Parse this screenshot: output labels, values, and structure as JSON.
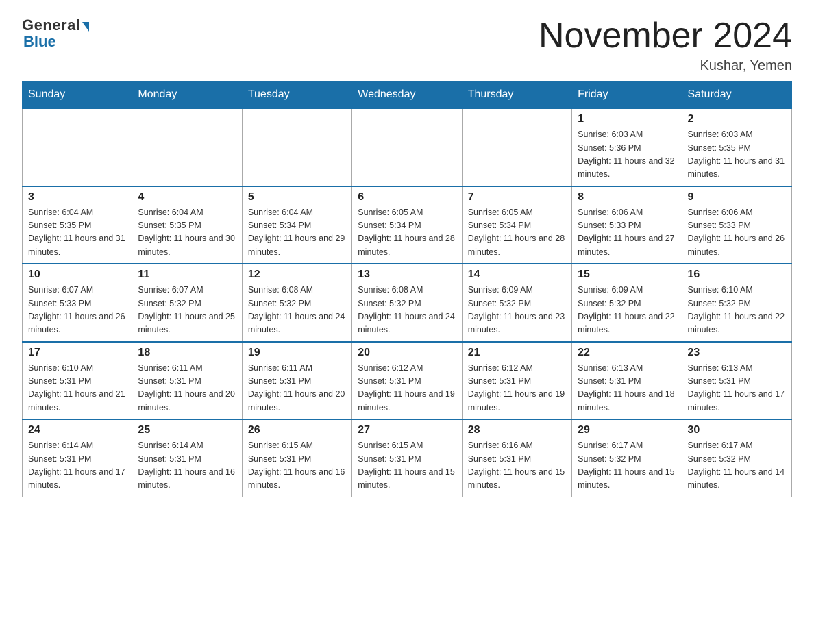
{
  "logo": {
    "general": "General",
    "blue": "Blue"
  },
  "title": "November 2024",
  "location": "Kushar, Yemen",
  "days_of_week": [
    "Sunday",
    "Monday",
    "Tuesday",
    "Wednesday",
    "Thursday",
    "Friday",
    "Saturday"
  ],
  "weeks": [
    [
      {
        "day": "",
        "info": ""
      },
      {
        "day": "",
        "info": ""
      },
      {
        "day": "",
        "info": ""
      },
      {
        "day": "",
        "info": ""
      },
      {
        "day": "",
        "info": ""
      },
      {
        "day": "1",
        "info": "Sunrise: 6:03 AM\nSunset: 5:36 PM\nDaylight: 11 hours and 32 minutes."
      },
      {
        "day": "2",
        "info": "Sunrise: 6:03 AM\nSunset: 5:35 PM\nDaylight: 11 hours and 31 minutes."
      }
    ],
    [
      {
        "day": "3",
        "info": "Sunrise: 6:04 AM\nSunset: 5:35 PM\nDaylight: 11 hours and 31 minutes."
      },
      {
        "day": "4",
        "info": "Sunrise: 6:04 AM\nSunset: 5:35 PM\nDaylight: 11 hours and 30 minutes."
      },
      {
        "day": "5",
        "info": "Sunrise: 6:04 AM\nSunset: 5:34 PM\nDaylight: 11 hours and 29 minutes."
      },
      {
        "day": "6",
        "info": "Sunrise: 6:05 AM\nSunset: 5:34 PM\nDaylight: 11 hours and 28 minutes."
      },
      {
        "day": "7",
        "info": "Sunrise: 6:05 AM\nSunset: 5:34 PM\nDaylight: 11 hours and 28 minutes."
      },
      {
        "day": "8",
        "info": "Sunrise: 6:06 AM\nSunset: 5:33 PM\nDaylight: 11 hours and 27 minutes."
      },
      {
        "day": "9",
        "info": "Sunrise: 6:06 AM\nSunset: 5:33 PM\nDaylight: 11 hours and 26 minutes."
      }
    ],
    [
      {
        "day": "10",
        "info": "Sunrise: 6:07 AM\nSunset: 5:33 PM\nDaylight: 11 hours and 26 minutes."
      },
      {
        "day": "11",
        "info": "Sunrise: 6:07 AM\nSunset: 5:32 PM\nDaylight: 11 hours and 25 minutes."
      },
      {
        "day": "12",
        "info": "Sunrise: 6:08 AM\nSunset: 5:32 PM\nDaylight: 11 hours and 24 minutes."
      },
      {
        "day": "13",
        "info": "Sunrise: 6:08 AM\nSunset: 5:32 PM\nDaylight: 11 hours and 24 minutes."
      },
      {
        "day": "14",
        "info": "Sunrise: 6:09 AM\nSunset: 5:32 PM\nDaylight: 11 hours and 23 minutes."
      },
      {
        "day": "15",
        "info": "Sunrise: 6:09 AM\nSunset: 5:32 PM\nDaylight: 11 hours and 22 minutes."
      },
      {
        "day": "16",
        "info": "Sunrise: 6:10 AM\nSunset: 5:32 PM\nDaylight: 11 hours and 22 minutes."
      }
    ],
    [
      {
        "day": "17",
        "info": "Sunrise: 6:10 AM\nSunset: 5:31 PM\nDaylight: 11 hours and 21 minutes."
      },
      {
        "day": "18",
        "info": "Sunrise: 6:11 AM\nSunset: 5:31 PM\nDaylight: 11 hours and 20 minutes."
      },
      {
        "day": "19",
        "info": "Sunrise: 6:11 AM\nSunset: 5:31 PM\nDaylight: 11 hours and 20 minutes."
      },
      {
        "day": "20",
        "info": "Sunrise: 6:12 AM\nSunset: 5:31 PM\nDaylight: 11 hours and 19 minutes."
      },
      {
        "day": "21",
        "info": "Sunrise: 6:12 AM\nSunset: 5:31 PM\nDaylight: 11 hours and 19 minutes."
      },
      {
        "day": "22",
        "info": "Sunrise: 6:13 AM\nSunset: 5:31 PM\nDaylight: 11 hours and 18 minutes."
      },
      {
        "day": "23",
        "info": "Sunrise: 6:13 AM\nSunset: 5:31 PM\nDaylight: 11 hours and 17 minutes."
      }
    ],
    [
      {
        "day": "24",
        "info": "Sunrise: 6:14 AM\nSunset: 5:31 PM\nDaylight: 11 hours and 17 minutes."
      },
      {
        "day": "25",
        "info": "Sunrise: 6:14 AM\nSunset: 5:31 PM\nDaylight: 11 hours and 16 minutes."
      },
      {
        "day": "26",
        "info": "Sunrise: 6:15 AM\nSunset: 5:31 PM\nDaylight: 11 hours and 16 minutes."
      },
      {
        "day": "27",
        "info": "Sunrise: 6:15 AM\nSunset: 5:31 PM\nDaylight: 11 hours and 15 minutes."
      },
      {
        "day": "28",
        "info": "Sunrise: 6:16 AM\nSunset: 5:31 PM\nDaylight: 11 hours and 15 minutes."
      },
      {
        "day": "29",
        "info": "Sunrise: 6:17 AM\nSunset: 5:32 PM\nDaylight: 11 hours and 15 minutes."
      },
      {
        "day": "30",
        "info": "Sunrise: 6:17 AM\nSunset: 5:32 PM\nDaylight: 11 hours and 14 minutes."
      }
    ]
  ]
}
